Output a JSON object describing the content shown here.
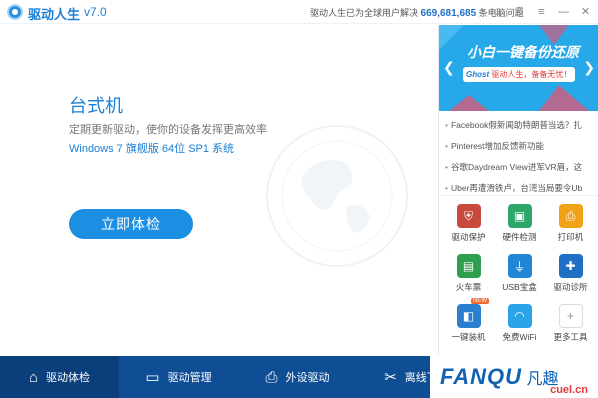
{
  "titlebar": {
    "app_name": "驱动人生",
    "version": "v7.0",
    "stats_prefix": "驱动人生已为全球用户解决",
    "stats_count": "669,681,685",
    "stats_suffix": "条电脑问题",
    "icons": [
      "chat-icon",
      "shirt-icon",
      "menu-icon",
      "minimize-icon",
      "close-icon"
    ]
  },
  "main": {
    "pc_type": "台式机",
    "subtitle": "定期更新驱动，使你的设备发挥更高效率",
    "os": "Windows 7 旗舰版  64位 SP1 系统",
    "check_button": "立即体检"
  },
  "banner": {
    "title": "小白一键备份还原",
    "ghost": "Ghost",
    "ghost_desc": "驱动人生，备备无忧！"
  },
  "news": [
    "Facebook假新闻助特朗普当选？扎",
    "Pinterest增加反馈新功能",
    "谷歌Daydream View进军VR眉，这",
    "Uber再遭滑铁卢，台湾当局要令Ub"
  ],
  "tools": [
    {
      "label": "驱动保护",
      "color": "#c84a3c",
      "icon": "shield-icon",
      "glyph": "⛨"
    },
    {
      "label": "硬件检测",
      "color": "#2ea86a",
      "icon": "monitor-icon",
      "glyph": "▣"
    },
    {
      "label": "打印机",
      "color": "#f2a219",
      "icon": "printer-icon",
      "glyph": "⎙"
    },
    {
      "label": "火车票",
      "color": "#2e9f4f",
      "icon": "train-icon",
      "glyph": "▤"
    },
    {
      "label": "USB宝盒",
      "color": "#1f86d8",
      "icon": "usb-icon",
      "glyph": "⏚"
    },
    {
      "label": "驱动诊所",
      "color": "#1f6fc4",
      "icon": "stethoscope-icon",
      "glyph": "✚"
    },
    {
      "label": "一键装机",
      "color": "#2b7fd0",
      "icon": "install-icon",
      "glyph": "◧",
      "badge": "NEW"
    },
    {
      "label": "免费WiFi",
      "color": "#2aa4e6",
      "icon": "wifi-icon",
      "glyph": "◠"
    },
    {
      "label": "更多工具",
      "color": "#ffffff",
      "icon": "more-icon",
      "glyph": "+"
    }
  ],
  "nav": [
    {
      "label": "驱动体检",
      "icon": "home-icon",
      "glyph": "⌂",
      "active": true
    },
    {
      "label": "驱动管理",
      "icon": "monitor-icon",
      "glyph": "▭",
      "active": false
    },
    {
      "label": "外设驱动",
      "icon": "printer-icon",
      "glyph": "⎙",
      "active": false
    },
    {
      "label": "离线下载",
      "icon": "tools-icon",
      "glyph": "✂",
      "active": false
    }
  ],
  "watermark": {
    "main": "FANQU",
    "cn": "凡趣",
    "sub": "cuel.cn"
  }
}
